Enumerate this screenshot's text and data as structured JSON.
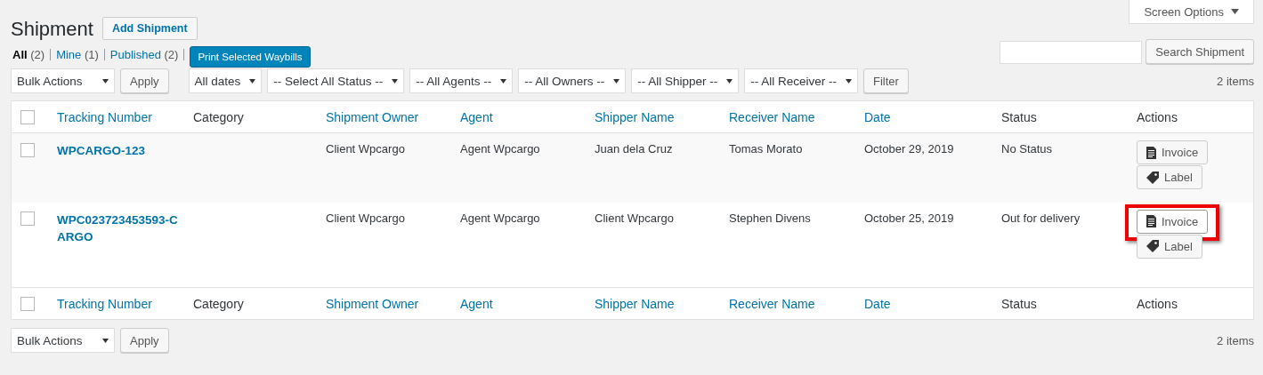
{
  "page_title": "Shipment",
  "add_button": "Add Shipment",
  "screen_options": "Screen Options",
  "views": [
    {
      "label": "All",
      "count": "(2)",
      "selected": true
    },
    {
      "label": "Mine",
      "count": "(1)",
      "selected": false
    },
    {
      "label": "Published",
      "count": "(2)",
      "selected": false
    }
  ],
  "print_button": "Print Selected Waybills",
  "search_button": "Search Shipment",
  "top_nav": {
    "bulk_actions": "Bulk Actions",
    "apply": "Apply",
    "filters": [
      "All dates",
      "-- Select All Status --",
      "-- All Agents --",
      "-- All Owners --",
      "-- All Shipper --",
      "-- All Receiver --"
    ],
    "filter_button": "Filter",
    "items": "2 items"
  },
  "header": {
    "checked": false,
    "columns": [
      {
        "label": "Tracking Number",
        "sortable": true
      },
      {
        "label": "Category",
        "sortable": false
      },
      {
        "label": "Shipment Owner",
        "sortable": true
      },
      {
        "label": "Agent",
        "sortable": true
      },
      {
        "label": "Shipper Name",
        "sortable": true
      },
      {
        "label": "Receiver Name",
        "sortable": true
      },
      {
        "label": "Date",
        "sortable": true
      },
      {
        "label": "Status",
        "sortable": false
      },
      {
        "label": "Actions",
        "sortable": false
      }
    ]
  },
  "rows": [
    {
      "checked": false,
      "tracking": "WPCARGO-123",
      "owner": "Client Wpcargo",
      "agent": "Agent Wpcargo",
      "shipper": "Juan dela Cruz",
      "receiver": "Tomas Morato",
      "date": "October 29, 2019",
      "status": "No Status",
      "actions": [
        {
          "kind": "invoice",
          "label": "Invoice",
          "highlighted": false
        },
        {
          "kind": "label",
          "label": "Label",
          "highlighted": false
        }
      ]
    },
    {
      "checked": false,
      "tracking": "WPC023723453593-CARGO",
      "owner": "Client Wpcargo",
      "agent": "Agent Wpcargo",
      "shipper": "Client Wpcargo",
      "receiver": "Stephen Divens",
      "date": "October 25, 2019",
      "status": "Out for delivery",
      "actions": [
        {
          "kind": "invoice",
          "label": "Invoice",
          "highlighted": true
        },
        {
          "kind": "label",
          "label": "Label",
          "highlighted": false
        }
      ]
    }
  ],
  "footer": {
    "checked": false,
    "columns": [
      {
        "label": "Tracking Number",
        "sortable": true
      },
      {
        "label": "Category",
        "sortable": false
      },
      {
        "label": "Shipment Owner",
        "sortable": true
      },
      {
        "label": "Agent",
        "sortable": true
      },
      {
        "label": "Shipper Name",
        "sortable": true
      },
      {
        "label": "Receiver Name",
        "sortable": true
      },
      {
        "label": "Date",
        "sortable": true
      },
      {
        "label": "Status",
        "sortable": false
      },
      {
        "label": "Actions",
        "sortable": false
      }
    ]
  },
  "bottom_nav": {
    "bulk_actions": "Bulk Actions",
    "apply": "Apply",
    "items": "2 items"
  }
}
